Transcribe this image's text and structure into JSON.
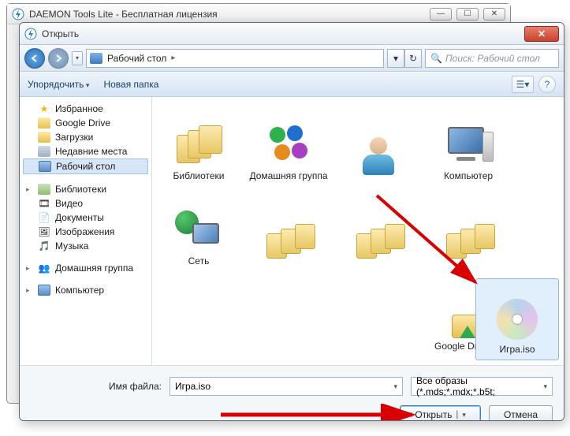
{
  "parent_window": {
    "title": "DAEMON Tools Lite - Бесплатная лицензия"
  },
  "dialog": {
    "title": "Открыть",
    "breadcrumb": {
      "location": "Рабочий стол"
    },
    "search_placeholder": "Поиск: Рабочий стол",
    "toolbar": {
      "organize": "Упорядочить",
      "new_folder": "Новая папка"
    },
    "tree": {
      "favorites_header": "Избранное",
      "favorites": [
        {
          "label": "Google Drive",
          "icon": "folder-icon"
        },
        {
          "label": "Загрузки",
          "icon": "folder-icon"
        },
        {
          "label": "Недавние места",
          "icon": "recent-places-icon"
        },
        {
          "label": "Рабочий стол",
          "icon": "desktop-icon",
          "selected": true
        }
      ],
      "libraries_header": "Библиотеки",
      "libraries": [
        {
          "label": "Видео",
          "icon": "video-library-icon"
        },
        {
          "label": "Документы",
          "icon": "documents-library-icon"
        },
        {
          "label": "Изображения",
          "icon": "pictures-library-icon"
        },
        {
          "label": "Музыка",
          "icon": "music-library-icon"
        }
      ],
      "homegroup": "Домашняя группа",
      "computer": "Компьютер"
    },
    "files": [
      {
        "label": "Библиотеки",
        "icon": "libraries-big-icon"
      },
      {
        "label": "Домашняя группа",
        "icon": "homegroup-big-icon"
      },
      {
        "label": "",
        "icon": "user-big-icon"
      },
      {
        "label": "Компьютер",
        "icon": "computer-big-icon"
      },
      {
        "label": "Сеть",
        "icon": "network-big-icon"
      },
      {
        "label": "",
        "icon": "folders-big-icon"
      },
      {
        "label": "",
        "icon": "folders-big-icon"
      },
      {
        "label": "",
        "icon": "folders-big-icon"
      },
      {
        "label": "Google Drive",
        "icon": "google-drive-big-icon"
      },
      {
        "label": "Игра.iso",
        "icon": "disc-big-icon",
        "selected": true
      }
    ],
    "footer": {
      "filename_label": "Имя файла:",
      "filename_value": "Игра.iso",
      "filter_value": "Все образы (*.mds;*.mdx;*.b5t;",
      "open_button": "Открыть",
      "cancel_button": "Отмена"
    }
  }
}
